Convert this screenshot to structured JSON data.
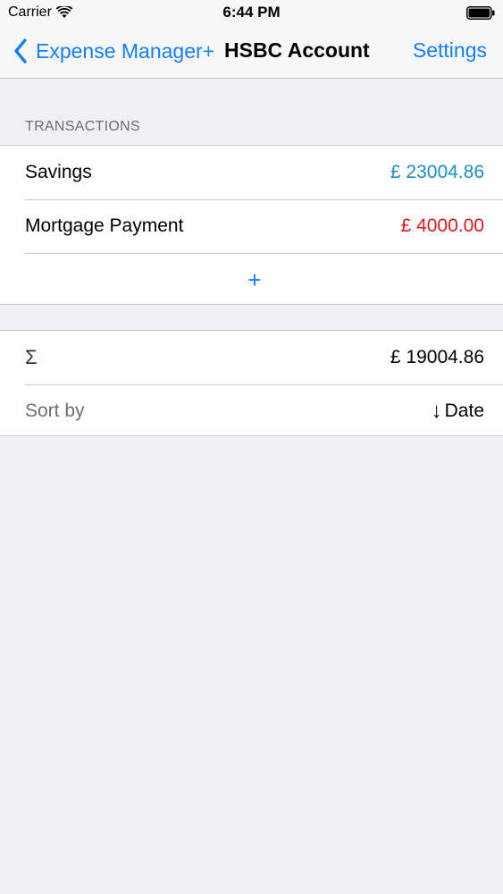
{
  "status_bar": {
    "carrier": "Carrier",
    "time": "6:44 PM",
    "wifi_icon": "wifi-icon",
    "battery_icon": "battery-icon"
  },
  "nav": {
    "back_label": "Expense Manager+",
    "title": "HSBC Account",
    "settings_label": "Settings",
    "accent_color": "#147efb"
  },
  "transactions": {
    "header": "TRANSACTIONS",
    "items": [
      {
        "name": "Savings",
        "amount": "£ 23004.86",
        "color": "#1b8fbf"
      },
      {
        "name": "Mortgage Payment",
        "amount": "£ 4000.00",
        "color": "#e0151b"
      }
    ],
    "add_label": "+"
  },
  "summary": {
    "sum_symbol": "Σ",
    "sum_value": "£ 19004.86",
    "sort_label": "Sort by",
    "sort_arrow": "↓",
    "sort_value": "Date"
  }
}
